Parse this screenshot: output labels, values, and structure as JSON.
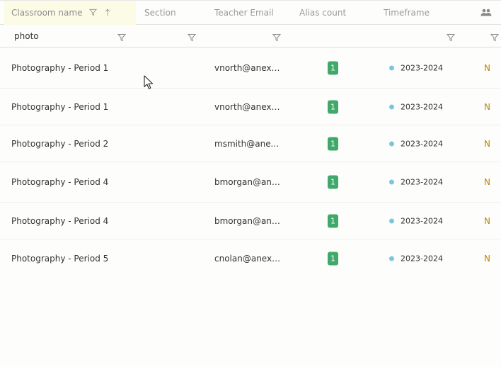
{
  "columns": {
    "classroom_name": "Classroom name",
    "section": "Section",
    "teacher_email": "Teacher Email",
    "alias_count": "Alias count",
    "timeframe": "Timeframe"
  },
  "filter": {
    "classroom_value": "photo"
  },
  "rows": [
    {
      "name": "Photography - Period 1",
      "email": "vnorth@anexam...",
      "alias_count": "1",
      "timeframe": "2023-2024",
      "extra": "N"
    },
    {
      "name": "Photography - Period 1",
      "email": "vnorth@anexam...",
      "alias_count": "1",
      "timeframe": "2023-2024",
      "extra": "N"
    },
    {
      "name": "Photography - Period 2",
      "email": "msmith@anexa...",
      "alias_count": "1",
      "timeframe": "2023-2024",
      "extra": "N"
    },
    {
      "name": "Photography - Period 4",
      "email": "bmorgan@anex...",
      "alias_count": "1",
      "timeframe": "2023-2024",
      "extra": "N"
    },
    {
      "name": "Photography - Period 4",
      "email": "bmorgan@anex...",
      "alias_count": "1",
      "timeframe": "2023-2024",
      "extra": "N"
    },
    {
      "name": "Photography - Period 5",
      "email": "cnolan@anexam...",
      "alias_count": "1",
      "timeframe": "2023-2024",
      "extra": "N"
    }
  ],
  "colors": {
    "badge": "#3fa86a",
    "timeframe_dot": "#7ec5dc",
    "sorted_header": "#fbfbe6"
  },
  "icons": {
    "sort": "sort-ascending-icon",
    "filter": "filter-funnel-icon",
    "people": "people-icon"
  }
}
